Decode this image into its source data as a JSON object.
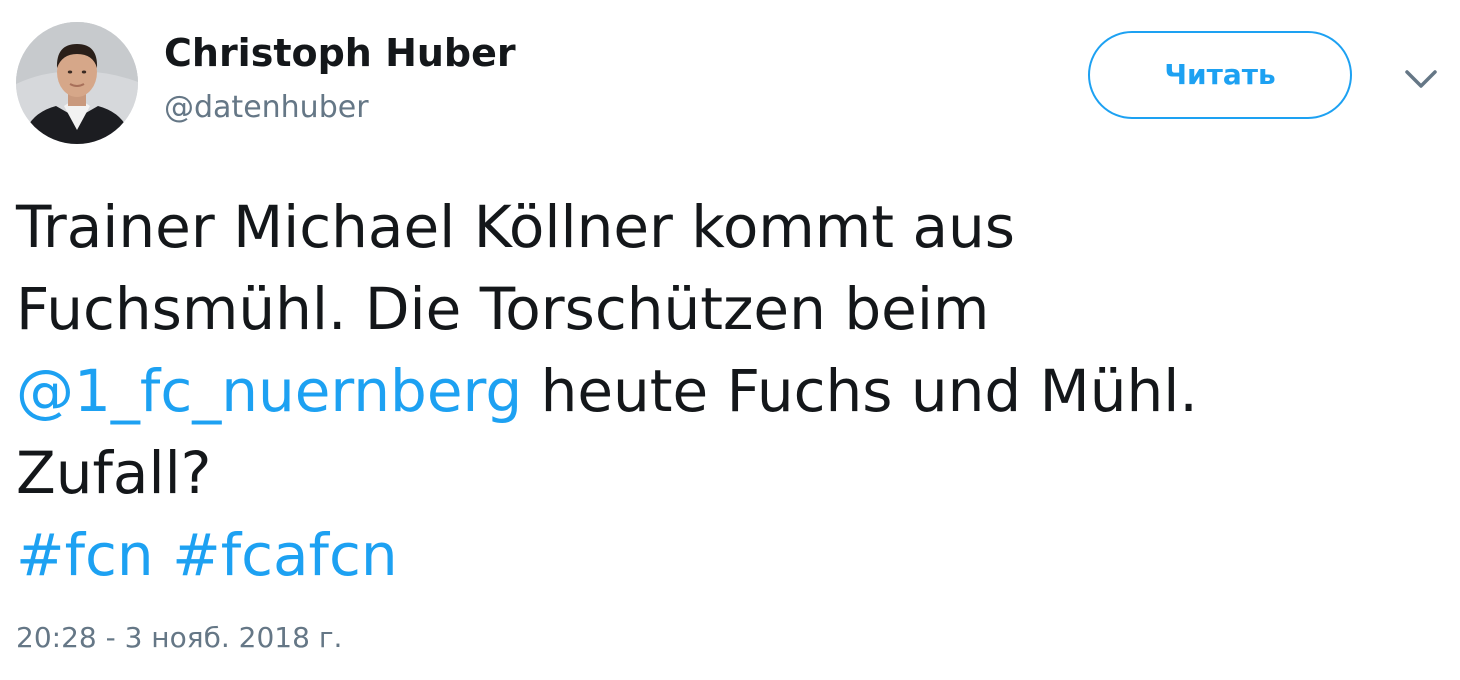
{
  "author": {
    "display_name": "Christoph Huber",
    "screen_name": "@datenhuber"
  },
  "follow_button": {
    "label": "Читать"
  },
  "tweet": {
    "line1": "Trainer Michael Köllner kommt aus",
    "line2": "Fuchsmühl. Die Torschützen beim",
    "mention": "@1_fc_nuernberg",
    "line3_rest": " heute Fuchs und Mühl.",
    "line4": "Zufall?",
    "hashtags": [
      "#fcn",
      "#fcafcn"
    ]
  },
  "timestamp": "20:28 - 3 нояб. 2018 г.",
  "icons": {
    "avatar": "profile-photo",
    "caret": "chevron-down-icon"
  },
  "colors": {
    "accent": "#1da1f2",
    "text": "#14171a",
    "secondary": "#657786"
  }
}
